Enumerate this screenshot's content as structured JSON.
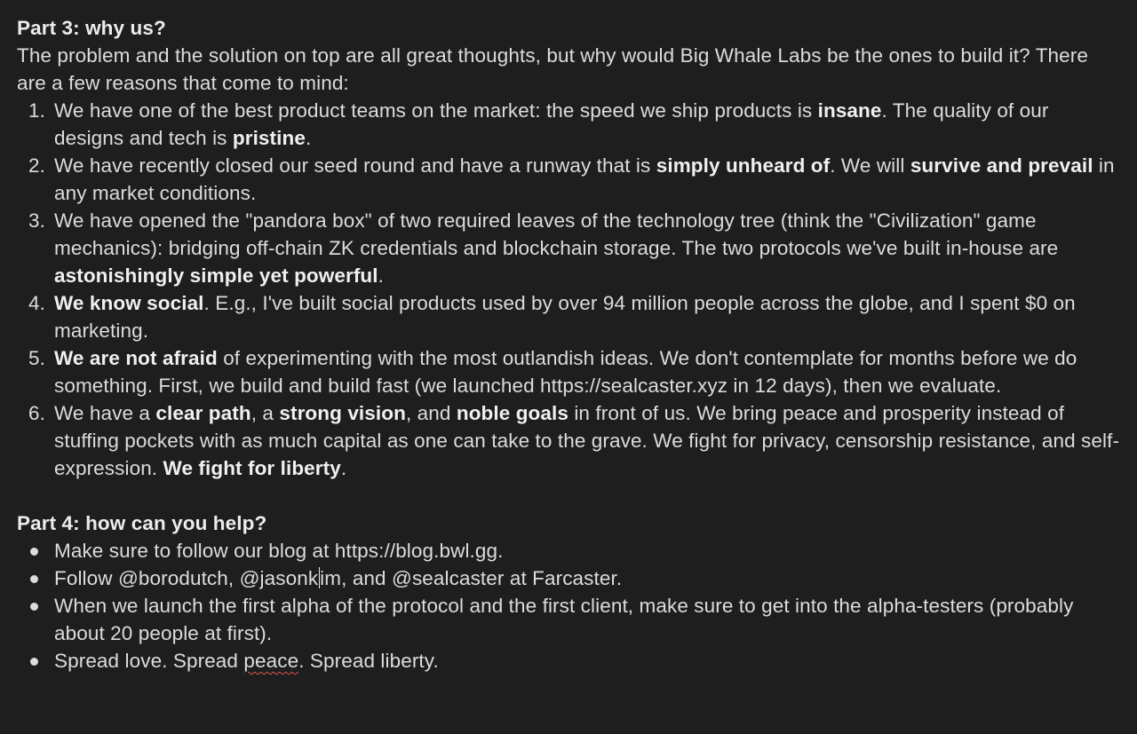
{
  "part3": {
    "heading": "Part 3: why us?",
    "intro": "The problem and the solution on top are all great thoughts, but why would Big Whale Labs be the ones to build it? There are a few reasons that come to mind:",
    "items": [
      {
        "num": "1.",
        "t1": "We have one of the best product teams on the market: the speed we ship products is ",
        "b1": "insane",
        "t2": ". The quality of our designs and tech is ",
        "b2": "pristine",
        "t3": "."
      },
      {
        "num": "2.",
        "t1": "We have recently closed our seed round and have a runway that is ",
        "b1": "simply unheard of",
        "t2": ". We will ",
        "b2": "survive and prevail",
        "t3": " in any market conditions."
      },
      {
        "num": "3.",
        "t1": "We have opened the \"pandora box\" of two required leaves of the technology tree (think the \"Civilization\" game mechanics): bridging off-chain ZK credentials and blockchain storage. The two protocols we've built in-house are ",
        "b1": "astonishingly simple yet powerful",
        "t2": "."
      },
      {
        "num": "4.",
        "b1": "We know social",
        "t1": ". E.g., I've built social products used by over 94 million people across the globe, and I spent $0 on marketing."
      },
      {
        "num": "5.",
        "b1": "We are not afraid",
        "t1": " of experimenting with the most outlandish ideas. We don't contemplate for months before we do something. First, we build and build fast (we launched https://sealcaster.xyz in 12 days), then we evaluate."
      },
      {
        "num": "6.",
        "t1": "We have a ",
        "b1": "clear path",
        "t2": ", a ",
        "b2": "strong vision",
        "t3": ", and ",
        "b3": "noble goals",
        "t4": " in front of us. We bring peace and prosperity instead of stuffing pockets with as much capital as one can take to the grave. We fight for privacy, censorship resistance, and self-expression. ",
        "b4": "We fight for liberty",
        "t5": "."
      }
    ]
  },
  "part4": {
    "heading": "Part 4: how can you help?",
    "items": [
      {
        "t1": "Make sure to follow our blog at https://blog.bwl.gg."
      },
      {
        "t1": "Follow @borodutch, @jasonk",
        "t2": "im, and @sealcaster at Farcaster."
      },
      {
        "t1": "When we launch the first alpha of the protocol and the first client, make sure to get into the alpha-testers (probably about 20 people at first)."
      },
      {
        "t1": "Spread love. Spread ",
        "w1": "peace",
        "t2": ". Spread liberty."
      }
    ]
  }
}
